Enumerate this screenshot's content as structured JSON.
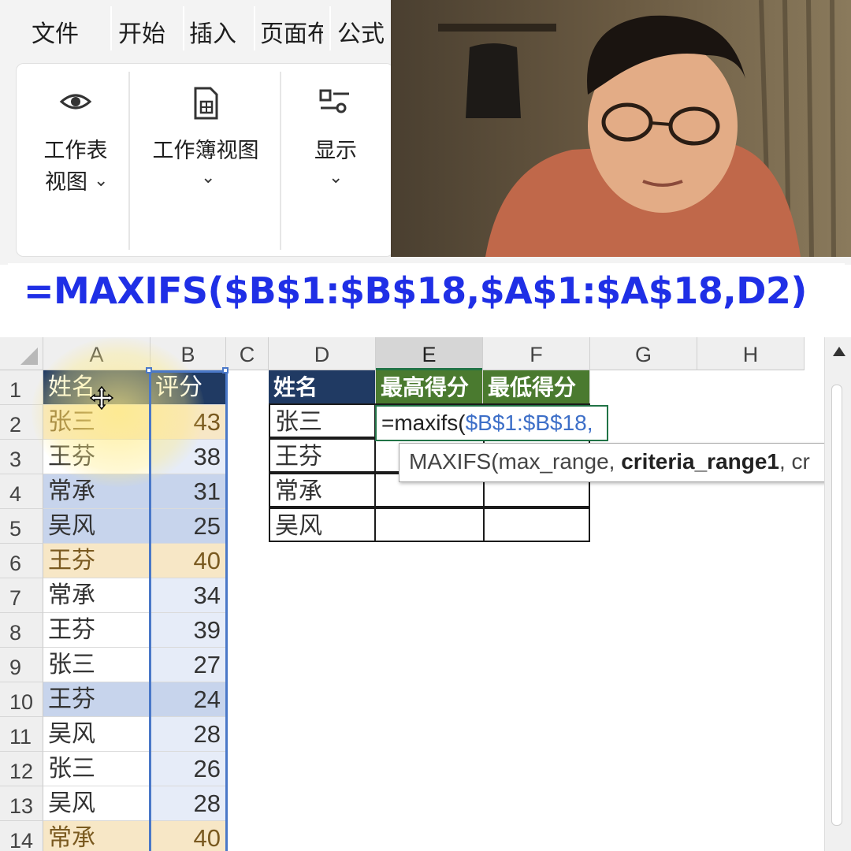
{
  "menu": {
    "tabs": [
      "文件",
      "开始",
      "插入",
      "页面布",
      "公式"
    ]
  },
  "ribbon": {
    "buttons": [
      {
        "label_line1": "工作表",
        "label_line2": "视图",
        "icon": "eye-icon"
      },
      {
        "label_line1": "工作簿视图",
        "label_line2": "",
        "icon": "workbook-icon"
      },
      {
        "label_line1": "显示",
        "label_line2": "",
        "icon": "display-options-icon"
      }
    ]
  },
  "formula_banner": {
    "text": "=MAXIFS($B$1:$B$18,$A$1:$A$18,D2)"
  },
  "grid": {
    "columns": [
      "A",
      "B",
      "C",
      "D",
      "E",
      "F",
      "G",
      "H"
    ],
    "active_column": "E",
    "rows": [
      "1",
      "2",
      "3",
      "4",
      "5",
      "6",
      "7",
      "8",
      "9",
      "10",
      "11",
      "12",
      "13",
      "14"
    ],
    "table_ab": {
      "header_name": "姓名",
      "header_score": "评分",
      "data": [
        {
          "name": "张三",
          "score": "43",
          "tint": "orange"
        },
        {
          "name": "王芬",
          "score": "38",
          "tint": "blue-light"
        },
        {
          "name": "常承",
          "score": "31",
          "tint": "blue"
        },
        {
          "name": "吴风",
          "score": "25",
          "tint": "blue"
        },
        {
          "name": "王芬",
          "score": "40",
          "tint": "orange"
        },
        {
          "name": "常承",
          "score": "34",
          "tint": "blue-light"
        },
        {
          "name": "王芬",
          "score": "39",
          "tint": "blue-light"
        },
        {
          "name": "张三",
          "score": "27",
          "tint": "blue-light"
        },
        {
          "name": "王芬",
          "score": "24",
          "tint": "blue"
        },
        {
          "name": "吴风",
          "score": "28",
          "tint": "blue-light"
        },
        {
          "name": "张三",
          "score": "26",
          "tint": "blue-light"
        },
        {
          "name": "吴风",
          "score": "28",
          "tint": "blue-light"
        },
        {
          "name": "常承",
          "score": "40",
          "tint": "orange"
        }
      ]
    },
    "table_def": {
      "header_name": "姓名",
      "header_max": "最高得分",
      "header_min": "最低得分",
      "names": [
        "张三",
        "王芬",
        "常承",
        "吴风"
      ]
    },
    "editing_cell": {
      "prefix": "=maxifs(",
      "reference": "$B$1:$B$18,"
    },
    "tooltip": {
      "func": "MAXIFS(max_range, ",
      "bold_arg": "criteria_range1",
      "rest": ", cr"
    }
  },
  "colors": {
    "formula_blue": "#1f2fe6",
    "header_dark_blue": "#203a63",
    "header_green": "#4a7a2f",
    "tint_orange": "#f7e7c6",
    "tint_blue": "#c7d4ec",
    "tint_blue_light": "#e6ecf8",
    "excel_green": "#217346"
  }
}
